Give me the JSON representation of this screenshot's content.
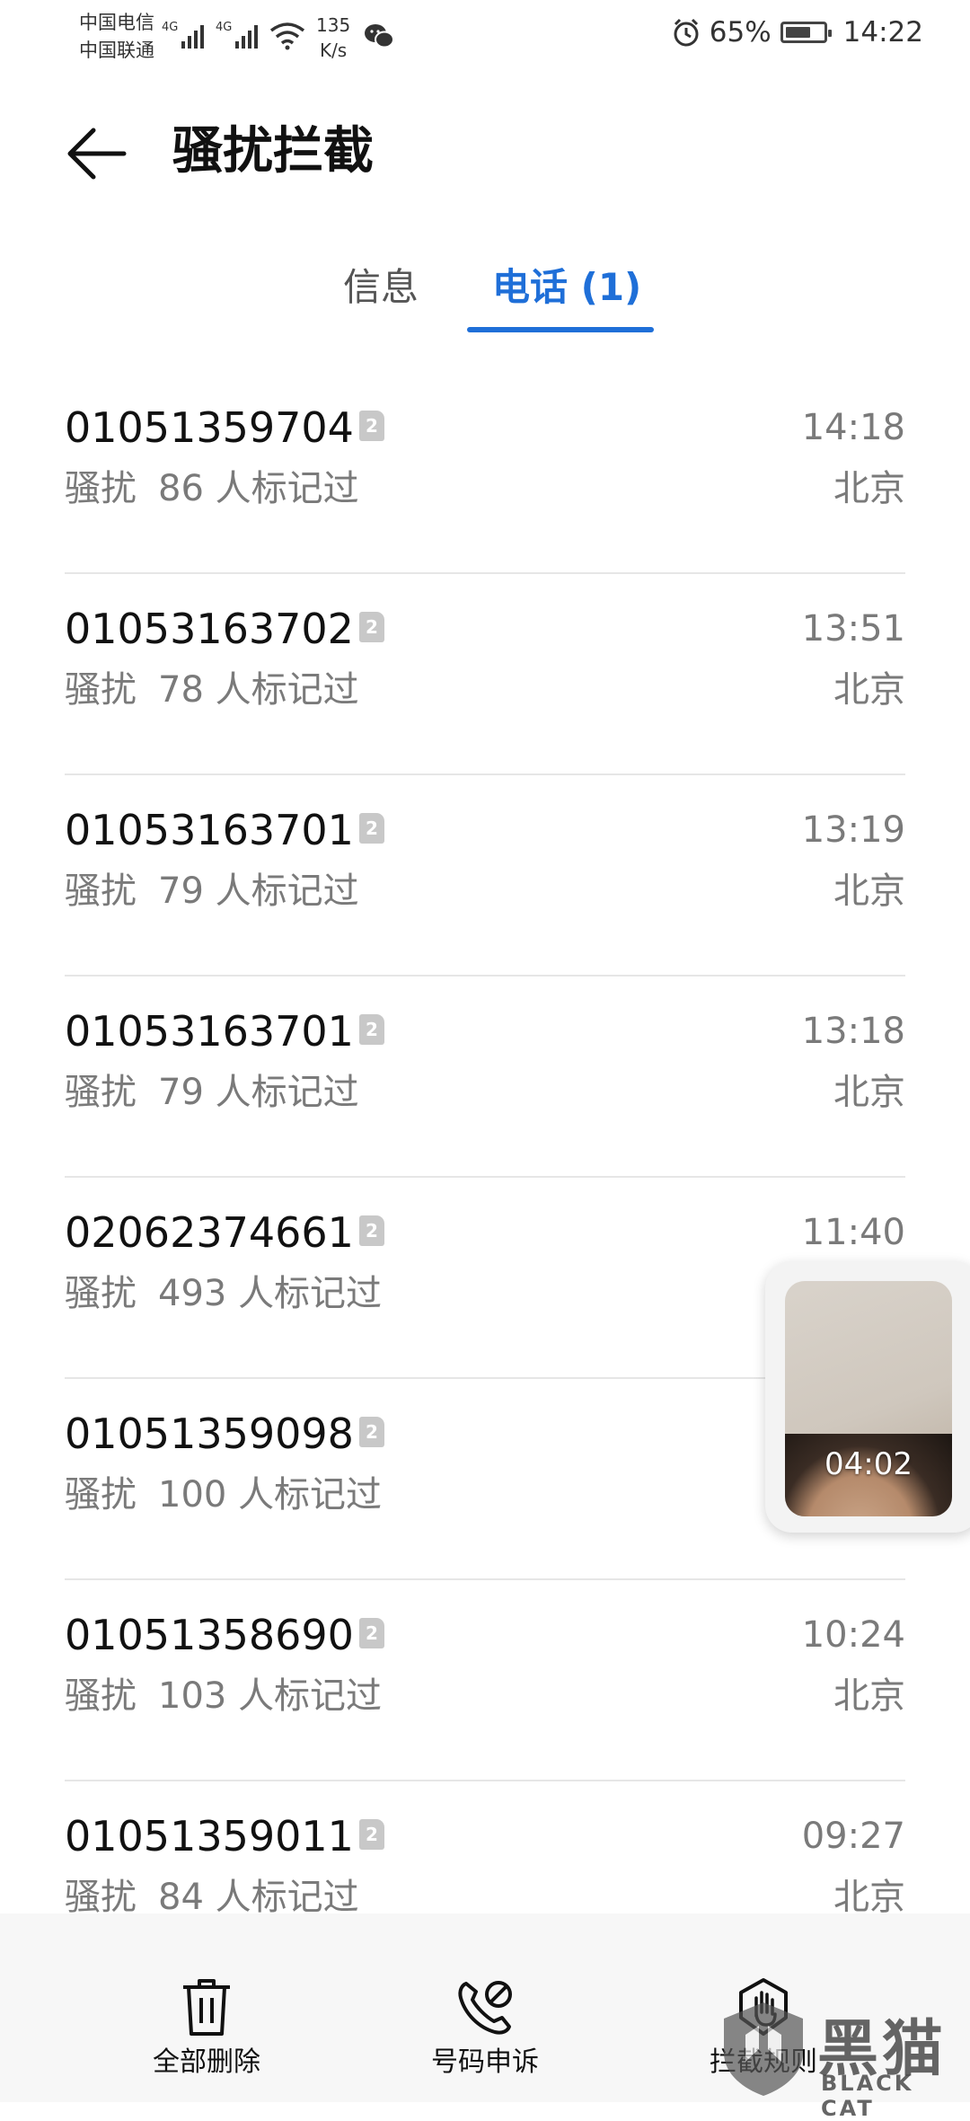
{
  "status_bar": {
    "carrier_1": "中国电信",
    "carrier_2": "中国联通",
    "network_1": "4G",
    "network_2": "4G",
    "speed_value": "135",
    "speed_unit": "K/s",
    "battery": "65%",
    "time": "14:22"
  },
  "header": {
    "title": "骚扰拦截"
  },
  "tabs": [
    {
      "label": "信息",
      "selected": false
    },
    {
      "label": "电话 (1)",
      "selected": true
    }
  ],
  "calls": [
    {
      "number": "01051359704",
      "sim": "2",
      "tag": "骚扰",
      "marked": "86 人标记过",
      "time": "14:18",
      "location": "北京"
    },
    {
      "number": "01053163702",
      "sim": "2",
      "tag": "骚扰",
      "marked": "78 人标记过",
      "time": "13:51",
      "location": "北京"
    },
    {
      "number": "01053163701",
      "sim": "2",
      "tag": "骚扰",
      "marked": "79 人标记过",
      "time": "13:19",
      "location": "北京"
    },
    {
      "number": "01053163701",
      "sim": "2",
      "tag": "骚扰",
      "marked": "79 人标记过",
      "time": "13:18",
      "location": "北京"
    },
    {
      "number": "02062374661",
      "sim": "2",
      "tag": "骚扰",
      "marked": "493 人标记过",
      "time": "11:40",
      "location": ""
    },
    {
      "number": "01051359098",
      "sim": "2",
      "tag": "骚扰",
      "marked": "100 人标记过",
      "time": "",
      "location": ""
    },
    {
      "number": "01051358690",
      "sim": "2",
      "tag": "骚扰",
      "marked": "103 人标记过",
      "time": "10:24",
      "location": "北京"
    },
    {
      "number": "01051359011",
      "sim": "2",
      "tag": "骚扰",
      "marked": "84 人标记过",
      "time": "09:27",
      "location": "北京"
    }
  ],
  "floating_window": {
    "duration": "04:02"
  },
  "bottom_bar": {
    "delete_all": "全部删除",
    "appeal": "号码申诉",
    "rules": "拦截规则"
  },
  "watermark": {
    "cn": "黑猫",
    "en": "BLACK CAT"
  },
  "colors": {
    "accent": "#1f6fd8",
    "secondary_text": "#7a7a7a",
    "divider": "#e6e6e6"
  }
}
